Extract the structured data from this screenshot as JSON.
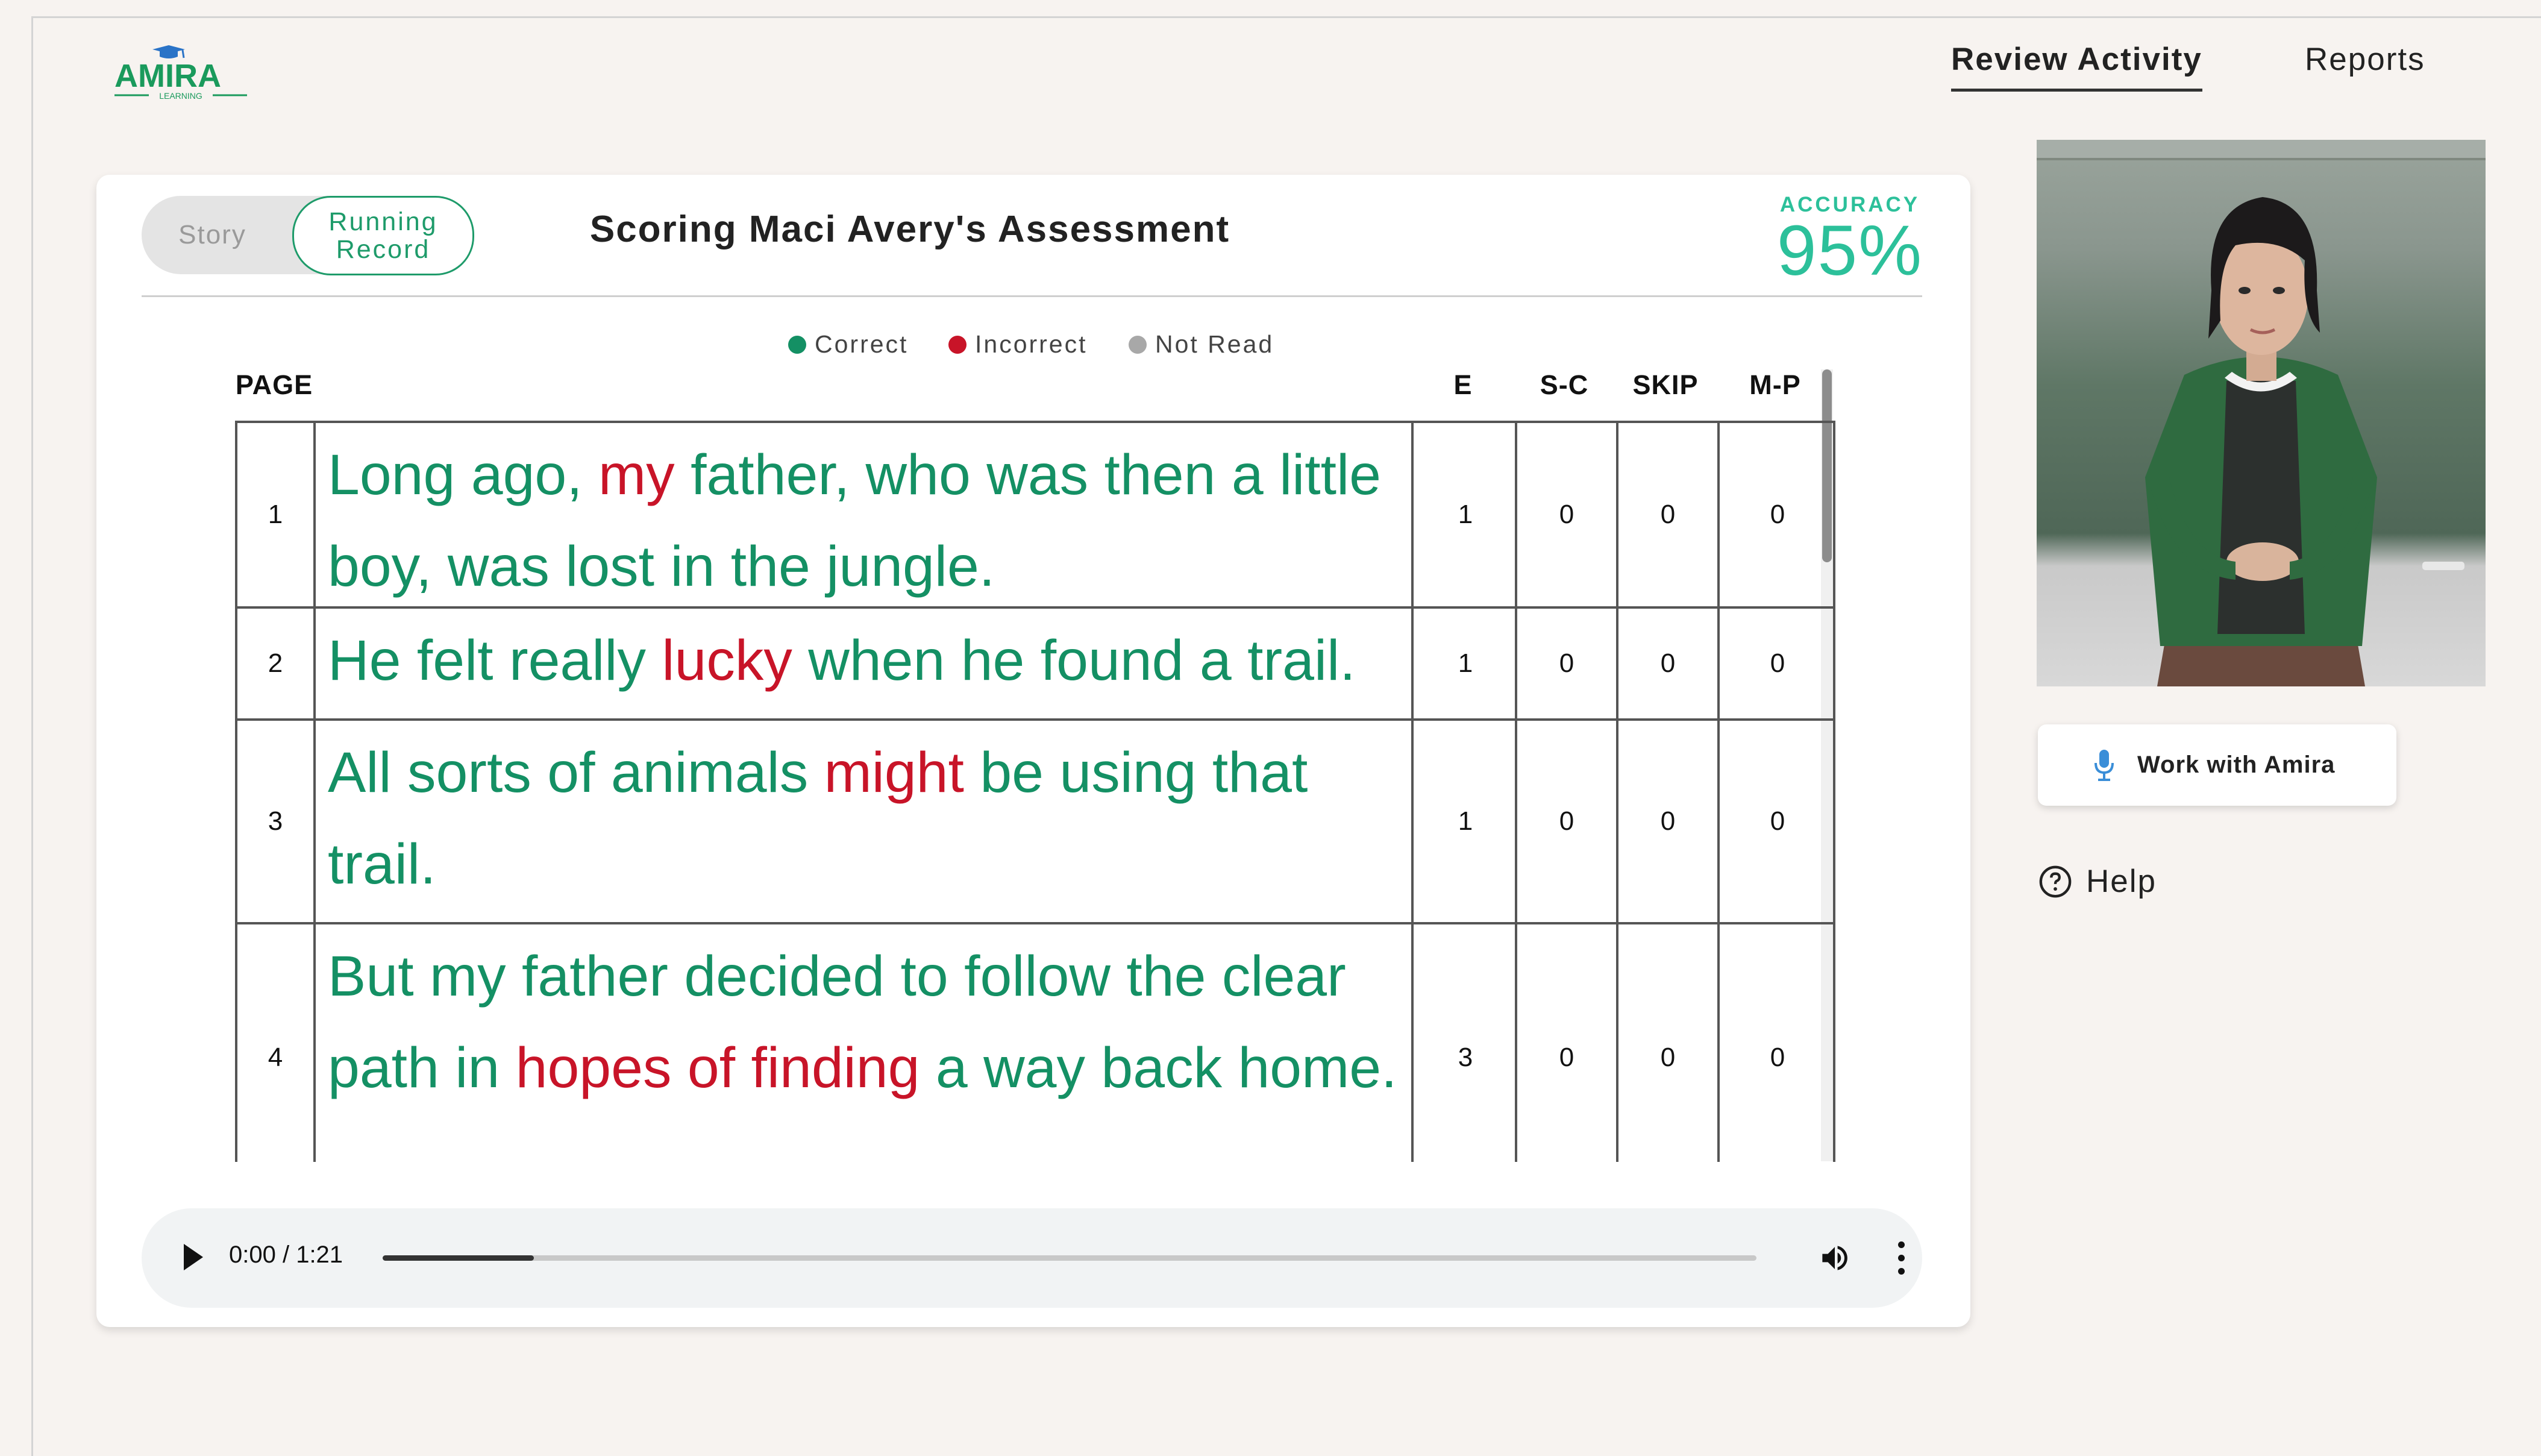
{
  "brand": {
    "logo_text": "AMIRA",
    "logo_subtext": "LEARNING"
  },
  "nav": {
    "review_activity": "Review Activity",
    "reports": "Reports"
  },
  "card": {
    "toggle": {
      "story": "Story",
      "running_record_line1": "Running",
      "running_record_line2": "Record",
      "selected": "Running Record"
    },
    "title": "Scoring Maci Avery's Assessment",
    "accuracy_label": "ACCURACY",
    "accuracy_value": "95%"
  },
  "legend": [
    {
      "label": "Correct",
      "color": "#149064"
    },
    {
      "label": "Incorrect",
      "color": "#c81428"
    },
    {
      "label": "Not Read",
      "color": "#a8a8a8"
    }
  ],
  "table": {
    "headers": {
      "page": "PAGE",
      "e": "E",
      "sc": "S-C",
      "skip": "SKIP",
      "mp": "M-P"
    },
    "rows": [
      {
        "page": "1",
        "e": "1",
        "sc": "0",
        "skip": "0",
        "mp": "0",
        "segments": [
          {
            "text": "Long ago, ",
            "status": "correct"
          },
          {
            "text": "my",
            "status": "incorrect"
          },
          {
            "text": " father, who was then a little boy, was lost in the jungle.",
            "status": "correct"
          }
        ]
      },
      {
        "page": "2",
        "e": "1",
        "sc": "0",
        "skip": "0",
        "mp": "0",
        "segments": [
          {
            "text": "He felt really ",
            "status": "correct"
          },
          {
            "text": "lucky",
            "status": "incorrect"
          },
          {
            "text": " when he found a trail.",
            "status": "correct"
          }
        ]
      },
      {
        "page": "3",
        "e": "1",
        "sc": "0",
        "skip": "0",
        "mp": "0",
        "segments": [
          {
            "text": "All sorts of animals ",
            "status": "correct"
          },
          {
            "text": "might",
            "status": "incorrect"
          },
          {
            "text": " be using that trail.",
            "status": "correct"
          }
        ]
      },
      {
        "page": "4",
        "e": "3",
        "sc": "0",
        "skip": "0",
        "mp": "0",
        "segments": [
          {
            "text": "But my father decided to follow the clear path in ",
            "status": "correct"
          },
          {
            "text": "hopes of finding",
            "status": "incorrect"
          },
          {
            "text": " a way back home.",
            "status": "correct"
          }
        ]
      }
    ]
  },
  "audio": {
    "time": "0:00 / 1:21",
    "progress": 0.11
  },
  "sidebar": {
    "work_button": "Work with Amira",
    "help": "Help"
  },
  "colors": {
    "correct": "#149064",
    "incorrect": "#c81428",
    "accent": "#2cc09a"
  },
  "icons": [
    "play-icon",
    "volume-icon",
    "more-vert-icon",
    "microphone-icon",
    "help-circle-icon"
  ]
}
